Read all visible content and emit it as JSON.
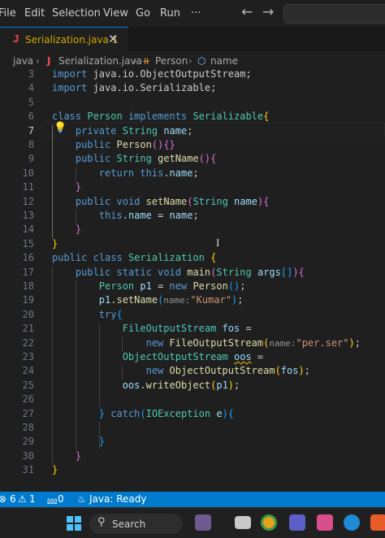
{
  "menubar": {
    "items": [
      "File",
      "Edit",
      "Selection",
      "View",
      "Go",
      "Run",
      "···"
    ],
    "back_icon": "arrow-left-icon",
    "forward_icon": "arrow-right-icon"
  },
  "tab": {
    "icon_letter": "J",
    "label": "Serialization.java 1",
    "close_glyph": "✕"
  },
  "breadcrumb": {
    "items": [
      "java",
      "Serialization.java",
      "Person",
      "name"
    ],
    "separator": "›",
    "file_icon_letter": "J",
    "class_icon_glyph": "⧺",
    "field_icon_glyph": "⬡"
  },
  "editor": {
    "active_line": 7,
    "lines": [
      {
        "n": 3,
        "tokens": [
          [
            "kw",
            "import"
          ],
          [
            "pl",
            " java.io.ObjectOutputStream;"
          ]
        ]
      },
      {
        "n": 4,
        "tokens": [
          [
            "kw",
            "import"
          ],
          [
            "pl",
            " java.io.Serializable;"
          ]
        ]
      },
      {
        "n": 5,
        "tokens": []
      },
      {
        "n": 6,
        "tokens": [
          [
            "kw",
            "class"
          ],
          [
            "pl",
            " "
          ],
          [
            "ty",
            "Person"
          ],
          [
            "pl",
            " "
          ],
          [
            "kw",
            "implements"
          ],
          [
            "pl",
            " "
          ],
          [
            "ty",
            "Serializable"
          ],
          [
            "br",
            "{"
          ]
        ]
      },
      {
        "n": 7,
        "tokens": [
          [
            "pl",
            "    "
          ],
          [
            "kw",
            "private"
          ],
          [
            "pl",
            " "
          ],
          [
            "ty",
            "String"
          ],
          [
            "pl",
            " "
          ],
          [
            "va",
            "name"
          ],
          [
            "pl",
            ";"
          ]
        ]
      },
      {
        "n": 8,
        "tokens": [
          [
            "pl",
            "    "
          ],
          [
            "kw",
            "public"
          ],
          [
            "pl",
            " "
          ],
          [
            "fn",
            "Person"
          ],
          [
            "b2",
            "()"
          ],
          [
            "b2",
            "{}"
          ]
        ]
      },
      {
        "n": 9,
        "tokens": [
          [
            "pl",
            "    "
          ],
          [
            "kw",
            "public"
          ],
          [
            "pl",
            " "
          ],
          [
            "ty",
            "String"
          ],
          [
            "pl",
            " "
          ],
          [
            "fn",
            "getName"
          ],
          [
            "b2",
            "(){"
          ]
        ]
      },
      {
        "n": 10,
        "tokens": [
          [
            "pl",
            "        "
          ],
          [
            "kw",
            "return"
          ],
          [
            "pl",
            " "
          ],
          [
            "kw",
            "this"
          ],
          [
            "pl",
            "."
          ],
          [
            "va",
            "name"
          ],
          [
            "pl",
            ";"
          ]
        ]
      },
      {
        "n": 11,
        "tokens": [
          [
            "pl",
            "    "
          ],
          [
            "b2",
            "}"
          ]
        ]
      },
      {
        "n": 12,
        "tokens": [
          [
            "pl",
            "    "
          ],
          [
            "kw",
            "public"
          ],
          [
            "pl",
            " "
          ],
          [
            "kw",
            "void"
          ],
          [
            "pl",
            " "
          ],
          [
            "fn",
            "setName"
          ],
          [
            "b2",
            "("
          ],
          [
            "ty",
            "String"
          ],
          [
            "pl",
            " "
          ],
          [
            "va",
            "name"
          ],
          [
            "b2",
            "){"
          ]
        ]
      },
      {
        "n": 13,
        "tokens": [
          [
            "pl",
            "        "
          ],
          [
            "kw",
            "this"
          ],
          [
            "pl",
            "."
          ],
          [
            "va",
            "name"
          ],
          [
            "pl",
            " = "
          ],
          [
            "va",
            "name"
          ],
          [
            "pl",
            ";"
          ]
        ]
      },
      {
        "n": 14,
        "tokens": [
          [
            "pl",
            "    "
          ],
          [
            "b2",
            "}"
          ]
        ]
      },
      {
        "n": 15,
        "tokens": [
          [
            "br",
            "}"
          ]
        ]
      },
      {
        "n": 16,
        "tokens": [
          [
            "kw",
            "public"
          ],
          [
            "pl",
            " "
          ],
          [
            "kw",
            "class"
          ],
          [
            "pl",
            " "
          ],
          [
            "ty",
            "Serialization"
          ],
          [
            "pl",
            " "
          ],
          [
            "br",
            "{"
          ]
        ]
      },
      {
        "n": 17,
        "tokens": [
          [
            "pl",
            "    "
          ],
          [
            "kw",
            "public"
          ],
          [
            "pl",
            " "
          ],
          [
            "kw",
            "static"
          ],
          [
            "pl",
            " "
          ],
          [
            "kw",
            "void"
          ],
          [
            "pl",
            " "
          ],
          [
            "fn",
            "main"
          ],
          [
            "b2",
            "("
          ],
          [
            "ty",
            "String"
          ],
          [
            "pl",
            " "
          ],
          [
            "va",
            "args"
          ],
          [
            "b3",
            "[]"
          ],
          [
            "b2",
            "){"
          ]
        ]
      },
      {
        "n": 18,
        "tokens": [
          [
            "pl",
            "        "
          ],
          [
            "ty",
            "Person"
          ],
          [
            "pl",
            " "
          ],
          [
            "va",
            "p1"
          ],
          [
            "pl",
            " = "
          ],
          [
            "kw",
            "new"
          ],
          [
            "pl",
            " "
          ],
          [
            "fn",
            "Person"
          ],
          [
            "b3",
            "()"
          ],
          [
            "pl",
            ";"
          ]
        ]
      },
      {
        "n": 19,
        "tokens": [
          [
            "pl",
            "        "
          ],
          [
            "va",
            "p1"
          ],
          [
            "pl",
            "."
          ],
          [
            "fn",
            "setName"
          ],
          [
            "b3",
            "("
          ],
          [
            "hint",
            "name:"
          ],
          [
            "st",
            "\"Kumar\""
          ],
          [
            "b3",
            ")"
          ],
          [
            "pl",
            ";"
          ]
        ]
      },
      {
        "n": 20,
        "tokens": [
          [
            "pl",
            "        "
          ],
          [
            "kw",
            "try"
          ],
          [
            "b3",
            "{"
          ]
        ]
      },
      {
        "n": 21,
        "tokens": [
          [
            "pl",
            "            "
          ],
          [
            "ty",
            "FileOutputStream"
          ],
          [
            "pl",
            " "
          ],
          [
            "va",
            "fos"
          ],
          [
            "pl",
            " ="
          ]
        ]
      },
      {
        "n": 22,
        "tokens": [
          [
            "pl",
            "                "
          ],
          [
            "kw",
            "new"
          ],
          [
            "pl",
            " "
          ],
          [
            "fn",
            "FileOutputStream"
          ],
          [
            "br",
            "("
          ],
          [
            "hint",
            "name:"
          ],
          [
            "st",
            "\"per.ser\""
          ],
          [
            "br",
            ")"
          ],
          [
            "pl",
            ";"
          ]
        ]
      },
      {
        "n": 23,
        "tokens": [
          [
            "pl",
            "            "
          ],
          [
            "ty",
            "ObjectOutputStream"
          ],
          [
            "pl",
            " "
          ],
          [
            "wv",
            "oos"
          ],
          [
            "pl",
            " ="
          ]
        ]
      },
      {
        "n": 24,
        "tokens": [
          [
            "pl",
            "                "
          ],
          [
            "kw",
            "new"
          ],
          [
            "pl",
            " "
          ],
          [
            "fn",
            "ObjectOutputStream"
          ],
          [
            "br",
            "("
          ],
          [
            "va",
            "fos"
          ],
          [
            "br",
            ")"
          ],
          [
            "pl",
            ";"
          ]
        ]
      },
      {
        "n": 25,
        "tokens": [
          [
            "pl",
            "            "
          ],
          [
            "va",
            "oos"
          ],
          [
            "pl",
            "."
          ],
          [
            "fn",
            "writeObject"
          ],
          [
            "br",
            "("
          ],
          [
            "va",
            "p1"
          ],
          [
            "br",
            ")"
          ],
          [
            "pl",
            ";"
          ]
        ]
      },
      {
        "n": 26,
        "tokens": []
      },
      {
        "n": 27,
        "tokens": [
          [
            "pl",
            "        "
          ],
          [
            "b3",
            "}"
          ],
          [
            "pl",
            " "
          ],
          [
            "kw",
            "catch"
          ],
          [
            "b3",
            "("
          ],
          [
            "ty",
            "IOException"
          ],
          [
            "pl",
            " "
          ],
          [
            "va",
            "e"
          ],
          [
            "b3",
            "){"
          ]
        ]
      },
      {
        "n": 28,
        "tokens": []
      },
      {
        "n": 29,
        "tokens": [
          [
            "pl",
            "        "
          ],
          [
            "b3",
            "}"
          ]
        ]
      },
      {
        "n": 30,
        "tokens": [
          [
            "pl",
            "    "
          ],
          [
            "b2",
            "}"
          ]
        ]
      },
      {
        "n": 31,
        "tokens": [
          [
            "br",
            "}"
          ]
        ]
      }
    ]
  },
  "statusbar": {
    "errors": "6",
    "warnings": "1",
    "ports": "0",
    "java_status": "Java: Ready",
    "error_glyph": "⊗",
    "warning_glyph": "⚠",
    "ports_glyph": "⅏",
    "java_glyph": "♨"
  },
  "taskbar": {
    "search_label": "Search"
  },
  "colors": {
    "kw": "#569cd6",
    "ty": "#4ec9b0",
    "fn": "#dcdcaa",
    "va": "#9cdcfe",
    "st": "#ce9178",
    "pl": "#cccccc",
    "br": "#ffd700",
    "b2": "#da70d6",
    "b3": "#179fff",
    "hint": "#969696",
    "wv": "#9cdcfe",
    "accent": "#007acc"
  }
}
